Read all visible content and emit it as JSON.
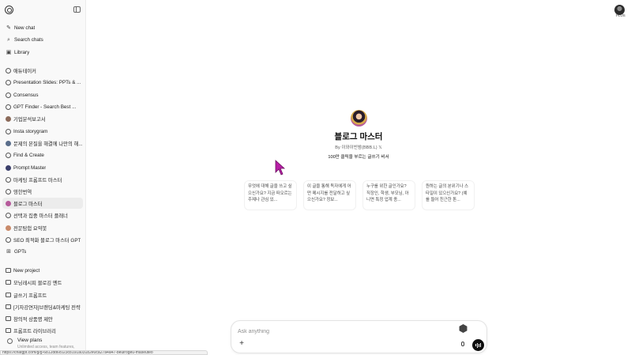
{
  "sidebar": {
    "new_chat": "New chat",
    "search_chats": "Search chats",
    "library": "Library",
    "gpts_list": [
      {
        "label": "애듀테이커",
        "icon": "circle-icon"
      },
      {
        "label": "Presentation Slides: PPTs & ...",
        "icon": "circle-icon"
      },
      {
        "label": "Consensus",
        "icon": "circle-icon"
      },
      {
        "label": "GPT Finder - Search Best ...",
        "icon": "circle-icon"
      },
      {
        "label": "기업분석보고서",
        "icon": "avatar"
      },
      {
        "label": "Insta storygram",
        "icon": "circle-icon"
      },
      {
        "label": "문제의 본질을 해결에 나만의 해...",
        "icon": "avatar"
      },
      {
        "label": "Find & Create",
        "icon": "circle-icon"
      },
      {
        "label": "Prompt Master",
        "icon": "avatar"
      },
      {
        "label": "마케팅 프롬프트 마스터",
        "icon": "circle-icon"
      },
      {
        "label": "영한번역",
        "icon": "circle-icon"
      },
      {
        "label": "블로그 마스터",
        "icon": "avatar"
      },
      {
        "label": "선택과 집중 마스터 플래너",
        "icon": "circle-icon"
      },
      {
        "label": "전문탐험 요약봇",
        "icon": "avatar"
      },
      {
        "label": "SEO 최적화 블로그 마스터 GPT",
        "icon": "circle-icon"
      },
      {
        "label": "GPTs",
        "icon": "grid-icon"
      }
    ],
    "new_project": "New project",
    "projects": [
      "모닝레시피 블로깅 멘트",
      "글쓰기 프롬프트",
      "[기자강연자]브랜딩&마케팅 전략",
      "창의적 상품명 제안",
      "프롬프트 라이브러리"
    ],
    "view_plans": "View plans",
    "view_plans_sub": "Unlimited access, team features,",
    "status_url": "https://chatgpt.com/g/g-6812dd6c023c8191a03182e0ca27a4a47-beulrogeu-maseuteo"
  },
  "header": {
    "plus_badge": "PLUS"
  },
  "gpt": {
    "title": "블로그 마스터",
    "by": "By 이와이빈밤(BBB.L) 𝕏",
    "description": "100만 클릭을 부르는 글쓰기 비서"
  },
  "starters": [
    "무엇에 대해 글을 쓰고 싶으신가요? 지금 떠오르는 주제나 관심 있...",
    "이 글을 통해 독자에게 어떤 메시지를 전달하고 싶으신가요? 정보...",
    "누구를 위한 글인가요? 직장인, 학생, 부모님, 아니면 특정 업계 종...",
    "원하는 글의 분위기나 스타일이 있으신가요? (예를 들어 친근한 톤..."
  ],
  "composer": {
    "placeholder": "Ask anything"
  },
  "colors": {
    "accent": "#0d0d0d",
    "sidebar_bg": "#f9f9f9",
    "cursor": "#b81ea6"
  }
}
